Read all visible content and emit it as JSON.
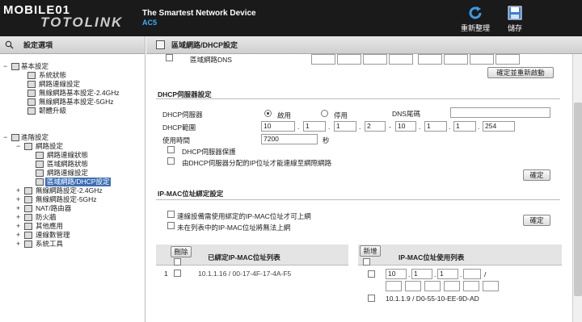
{
  "header": {
    "logo_top": "MOBILE01",
    "logo_bottom": "TOTOLINK",
    "tagline": "The Smartest Network Device",
    "model": "AC5",
    "reboot_label": "重新整理",
    "save_label": "儲存"
  },
  "sidebar": {
    "title": "設定選項",
    "items": [
      {
        "label": "基本設定"
      },
      {
        "label": "系統狀態"
      },
      {
        "label": "網路連線設定"
      },
      {
        "label": "無線網路基本設定-2.4GHz"
      },
      {
        "label": "無線網路基本設定-5GHz"
      },
      {
        "label": "韌體升級"
      },
      {
        "label": "進階設定"
      },
      {
        "label": "網路設定"
      },
      {
        "label": "網路連線狀態"
      },
      {
        "label": "區域網路狀態"
      },
      {
        "label": "網路連線設定"
      },
      {
        "label": "區域網路/DHCP設定"
      },
      {
        "label": "無線網路設定-2.4GHz"
      },
      {
        "label": "無線網路設定-5GHz"
      },
      {
        "label": "NAT/路由器"
      },
      {
        "label": "防火牆"
      },
      {
        "label": "其他應用"
      },
      {
        "label": "連線數管理"
      },
      {
        "label": "系統工具"
      }
    ]
  },
  "main": {
    "title": "區域網路/DHCP設定",
    "lan_dns_label": "區域網路DNS",
    "apply_restart_label": "確定並重新啟動",
    "dhcp_section_title": "DHCP伺服器設定",
    "dhcp_server_label": "DHCP伺服器",
    "enable_label": "啟用",
    "disable_label": "停用",
    "dns_suffix_label": "DNS尾碼",
    "dhcp_range_label": "DHCP範圍",
    "range_start": [
      "10",
      "1",
      "1",
      "2"
    ],
    "range_end": [
      "10",
      "1",
      "1",
      "254"
    ],
    "lease_label": "使用時間",
    "lease_value": "7200",
    "lease_unit": "秒",
    "dhcp_protect_label": "DHCP伺服器保護",
    "dhcp_only_label": "由DHCP伺服器分配的IP位址才能連線至網際網路",
    "confirm_label": "確定",
    "ipmac_section_title": "IP-MAC位址綁定設定",
    "ipmac_require_label": "連線設備需使用綁定的IP-MAC位址才可上網",
    "ipmac_block_label": "未在列表中的IP-MAC位址將無法上網",
    "confirm2_label": "確定",
    "delete_label": "刪除",
    "bound_list_title": "已綁定IP-MAC位址列表",
    "bound_rows": [
      {
        "index": "1",
        "value": "10.1.1.16 / 00-17-4F-17-4A-F5"
      }
    ],
    "add_label": "新增",
    "used_list_title": "IP-MAC位址使用列表",
    "used_ip": [
      "10",
      "1",
      "1",
      "",
      "/"
    ],
    "used_rows": [
      {
        "value": "10.1.1.9 / D0-55-10-EE-9D-AD"
      }
    ]
  },
  "colors": {
    "header_bg": "#1a1a1a",
    "model_accent": "#3ab0ff",
    "selected_bg": "#3c6fb6"
  }
}
